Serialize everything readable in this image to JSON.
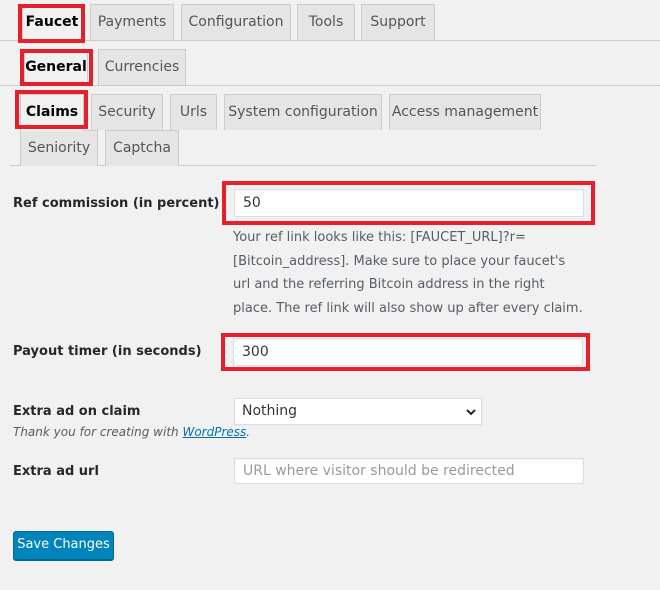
{
  "tabs_row1": [
    "Faucet",
    "Payments",
    "Configuration",
    "Tools",
    "Support"
  ],
  "tabs_row2": [
    "General",
    "Currencies"
  ],
  "tabs_row3": [
    "Claims",
    "Security",
    "Urls",
    "System configuration",
    "Access management"
  ],
  "tabs_row4": [
    "Seniority",
    "Captcha"
  ],
  "fields": {
    "ref_commission": {
      "label": "Ref commission (in percent)",
      "value": "50",
      "description": "Your ref link looks like this: [FAUCET_URL]?r=[Bitcoin_address]. Make sure to place your faucet's url and the referring Bitcoin address in the right place. The ref link will also show up after every claim."
    },
    "payout_timer": {
      "label": "Payout timer (in seconds)",
      "value": "300"
    },
    "extra_ad_claim": {
      "label": "Extra ad on claim",
      "selected": "Nothing"
    },
    "extra_ad_url": {
      "label": "Extra ad url",
      "placeholder": "URL where visitor should be redirected"
    }
  },
  "footer": {
    "thanks_prefix": "Thank you for creating with ",
    "link_text": "WordPress",
    "suffix": "."
  },
  "save_button_label": "Save Changes",
  "colors": {
    "highlight": "#e3202b",
    "primary_button": "#0085ba",
    "link": "#0073aa"
  }
}
